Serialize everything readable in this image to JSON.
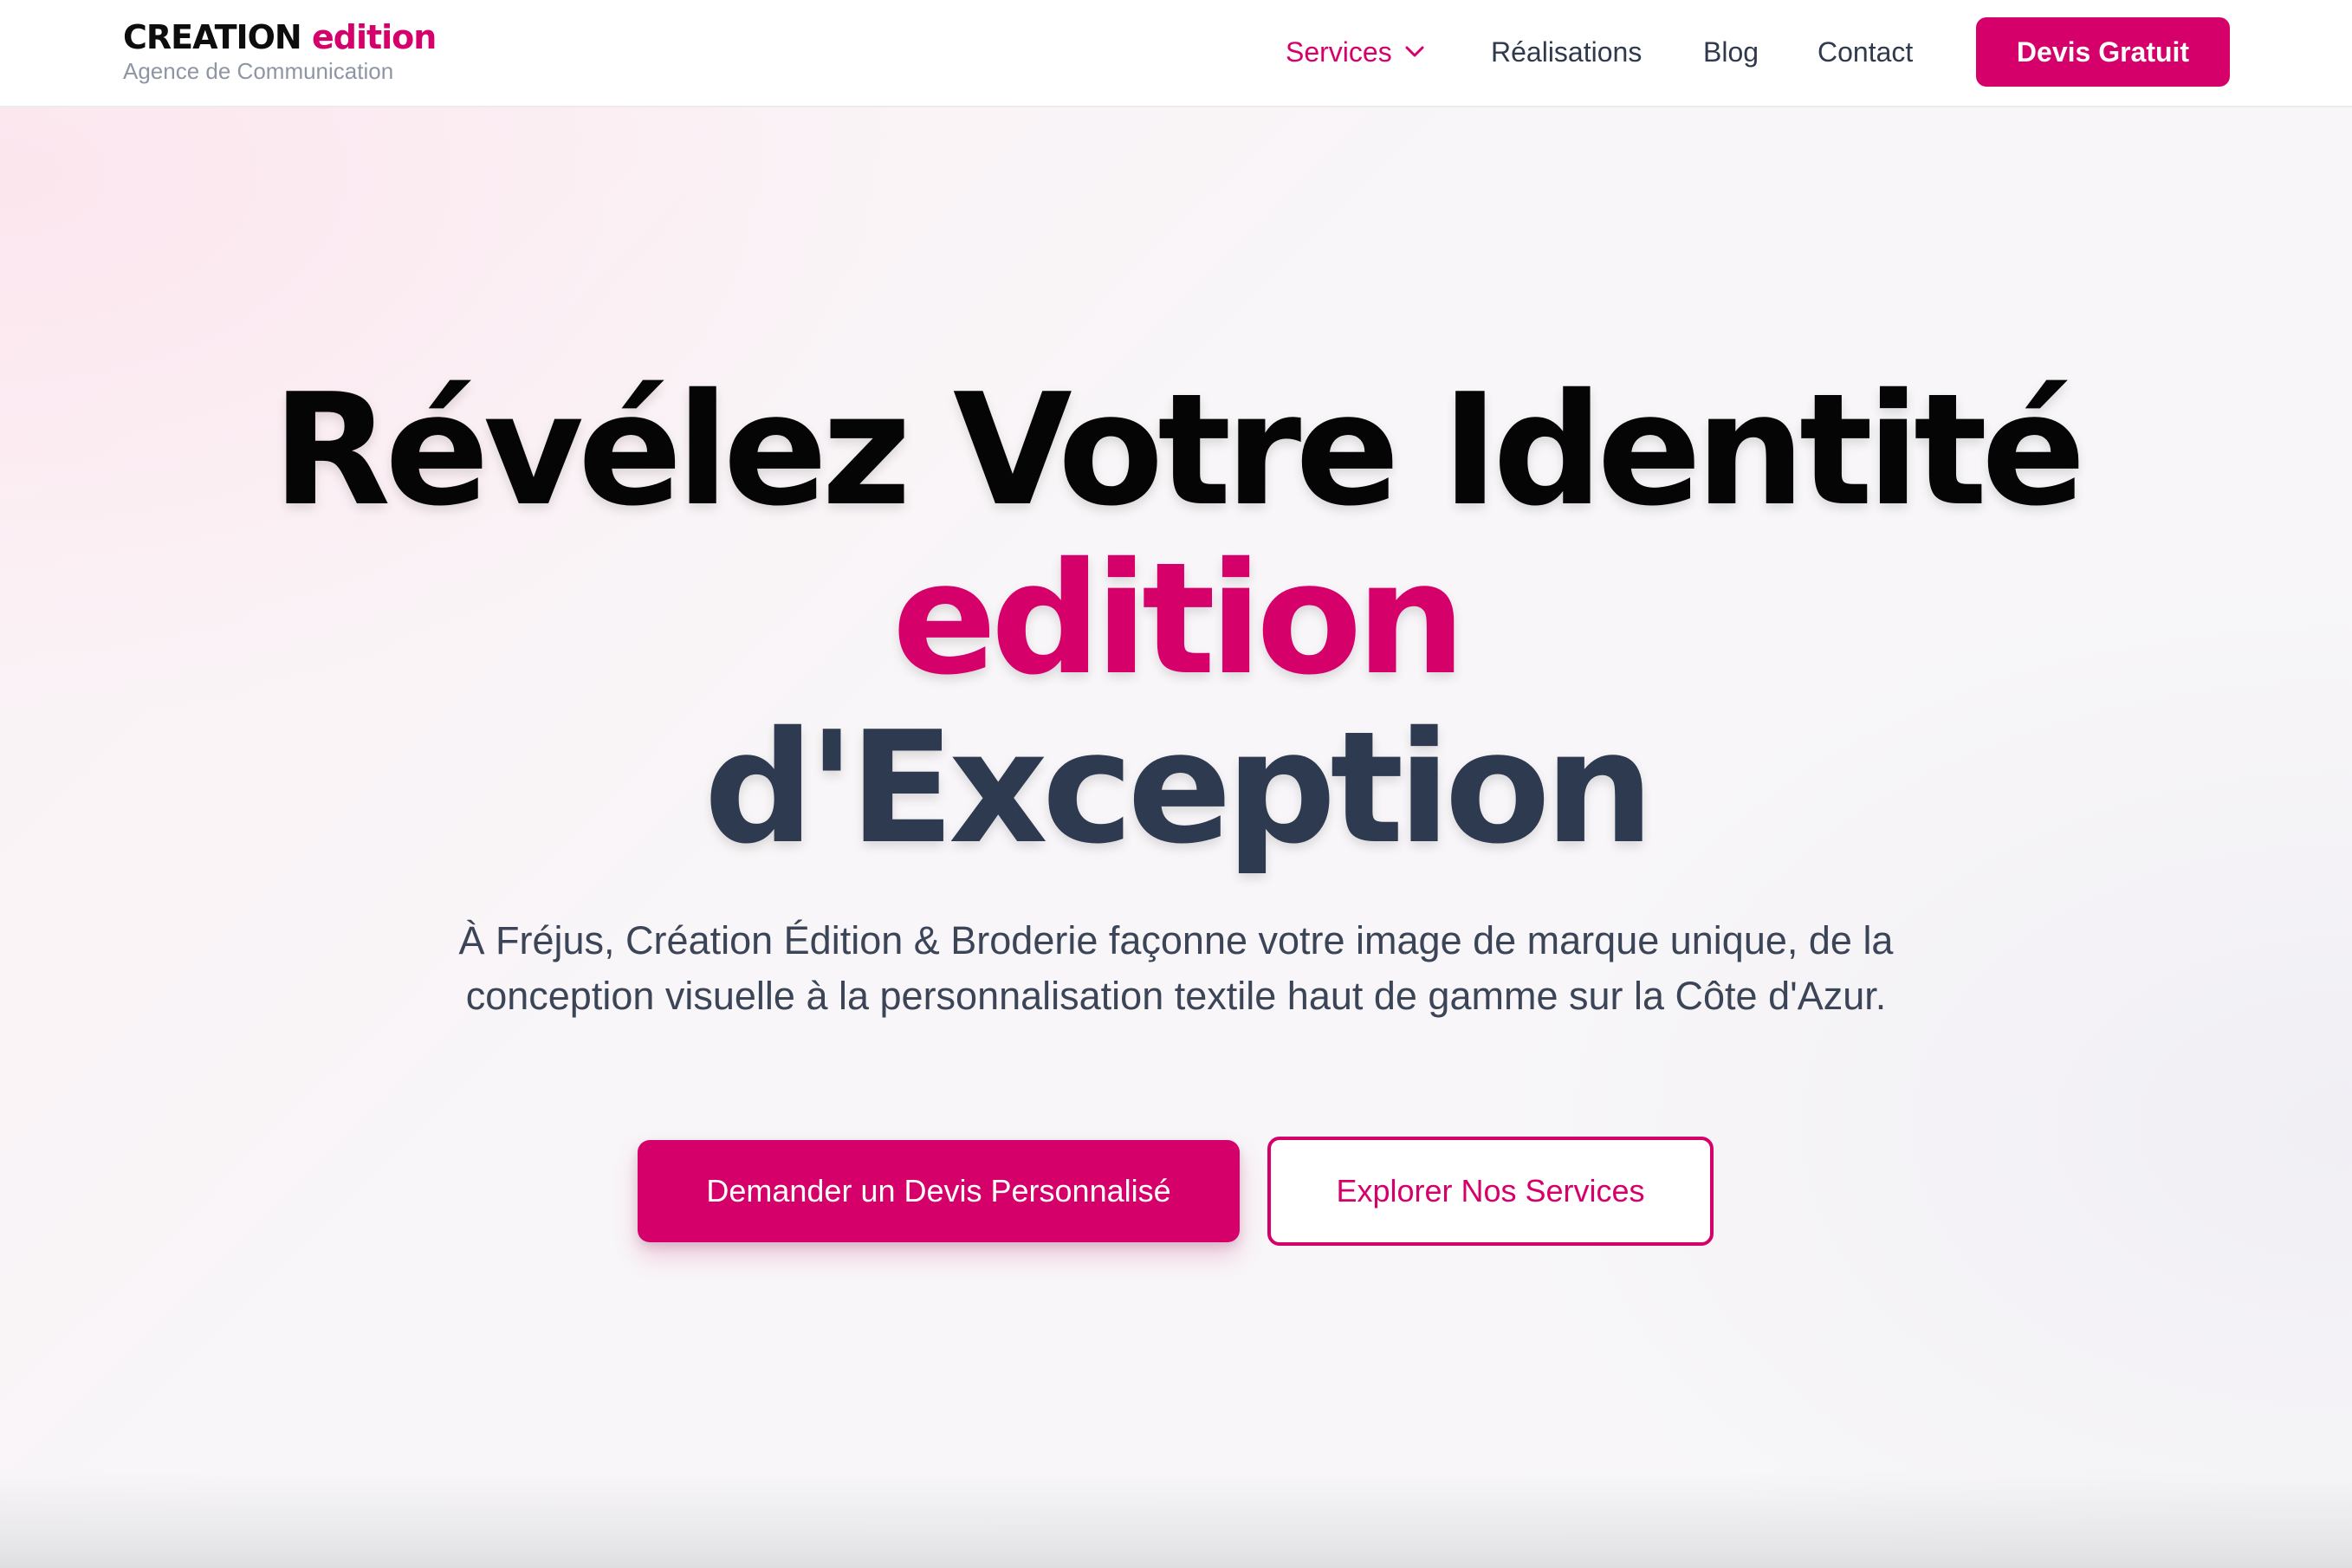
{
  "header": {
    "brand": {
      "name_part1": "CREATION",
      "name_part2": "edition",
      "tagline": "Agence de Communication"
    },
    "nav": {
      "services": "Services",
      "realisations": "Réalisations",
      "blog": "Blog",
      "contact": "Contact"
    },
    "cta_label": "Devis Gratuit"
  },
  "hero": {
    "title_line1": "Révélez Votre Identité",
    "title_line2": "edition",
    "title_line3": "d'Exception",
    "subtitle": "À Fréjus, Création Édition & Broderie façonne votre image de marque unique, de la conception visuelle à la personnalisation textile haut de gamme sur la Côte d'Azur.",
    "primary_button": "Demander un Devis Personnalisé",
    "secondary_button": "Explorer Nos Services"
  },
  "icons": {
    "services_dropdown": "chevron-down-icon"
  },
  "colors": {
    "accent": "#d6006b",
    "heading_dark": "#050505",
    "heading_slate": "#2d3a4f",
    "body_text": "#3b4557",
    "tagline": "#8e96a3"
  }
}
